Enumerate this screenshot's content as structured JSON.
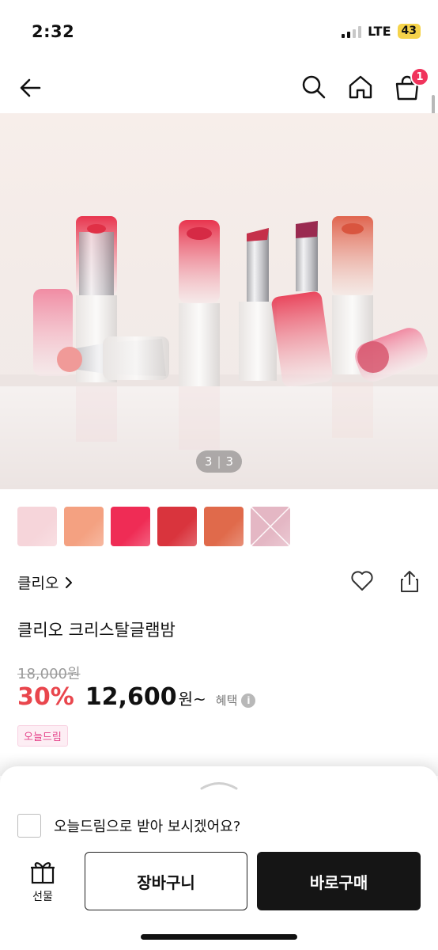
{
  "status_bar": {
    "time": "2:32",
    "network": "LTE",
    "battery": "43"
  },
  "header": {
    "back_icon": "arrow-left-icon",
    "search_icon": "search-icon",
    "home_icon": "home-icon",
    "cart_icon": "shopping-bag-icon",
    "cart_count": "1"
  },
  "gallery": {
    "current": "3",
    "total": "3"
  },
  "swatches": [
    {
      "name": "pale-pink",
      "color": "#f6d5da"
    },
    {
      "name": "peach",
      "color": "#f4a181"
    },
    {
      "name": "hot-pink",
      "color": "#ef2c55"
    },
    {
      "name": "red",
      "color": "#d9343d"
    },
    {
      "name": "coral",
      "color": "#e06a4b"
    },
    {
      "name": "sold-out-mauve",
      "color": "#e4b7c4"
    }
  ],
  "product": {
    "brand": "클리오",
    "title": "클리오 크리스탈글램밤",
    "original_price": "18,000원",
    "discount": "30%",
    "sale_price": "12,600",
    "currency_suffix": "원~",
    "benefit_label": "혜택",
    "info_icon": "i",
    "delivery_tag": "오늘드림"
  },
  "bottom_sheet": {
    "checkbox_label": "오늘드림으로 받아 보시겠어요?",
    "gift_label": "선물",
    "cart_button": "장바구니",
    "buy_button": "바로구매"
  },
  "colors": {
    "accent_red": "#e9464d",
    "badge_pink": "#f0345c",
    "buy_button_bg": "#151515"
  }
}
